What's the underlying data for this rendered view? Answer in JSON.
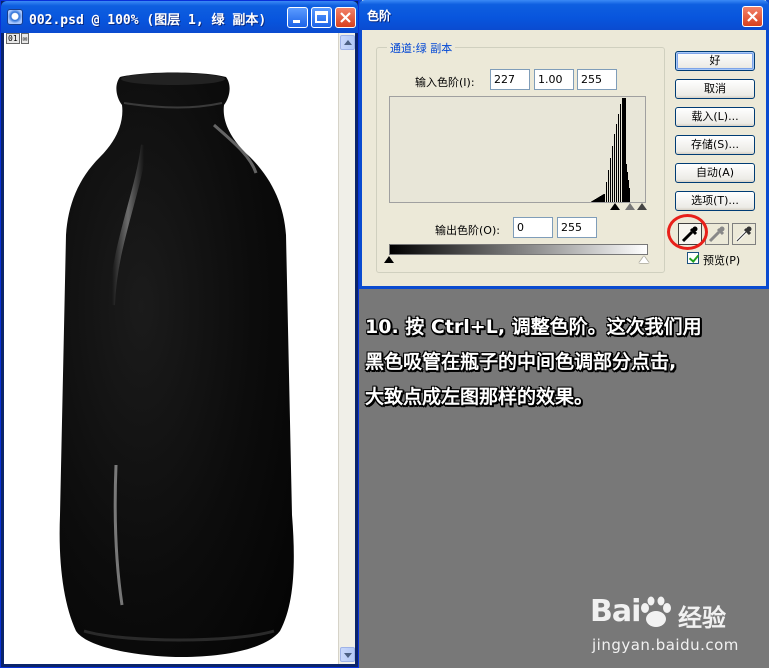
{
  "document_window": {
    "title": "002.psd @ 100% (图层 1, 绿 副本)",
    "status_badges": [
      "01",
      "✉"
    ]
  },
  "levels_dialog": {
    "title": "色阶",
    "channel_label": "通道:绿 副本",
    "input_levels_label": "输入色阶(I):",
    "input_levels": [
      "227",
      "1.00",
      "255"
    ],
    "output_levels_label": "输出色阶(O):",
    "output_levels": [
      "0",
      "255"
    ],
    "buttons": {
      "ok": "好",
      "cancel": "取消",
      "load": "载入(L)...",
      "save": "存储(S)...",
      "auto": "自动(A)",
      "options": "选项(T)..."
    },
    "preview_label": "预览(P)",
    "preview_checked": true,
    "eyedroppers": [
      "black-eyedropper-icon",
      "gray-eyedropper-icon",
      "white-eyedropper-icon"
    ],
    "highlight_color": "#e8201a"
  },
  "instruction": {
    "lines": [
      "10. 按 Ctrl+L, 调整色阶。这次我们用",
      "黑色吸管在瓶子的中间色调部分点击,",
      "大致点成左图那样的效果。"
    ]
  },
  "watermark": {
    "brand": "Bai",
    "brand_suffix": "经验",
    "url": "jingyan.baidu.com"
  },
  "colors": {
    "xp_title_blue": "#0855dd",
    "dialog_face": "#ece9d8",
    "group_label_blue": "#0046d5",
    "background_gray": "#787878"
  }
}
